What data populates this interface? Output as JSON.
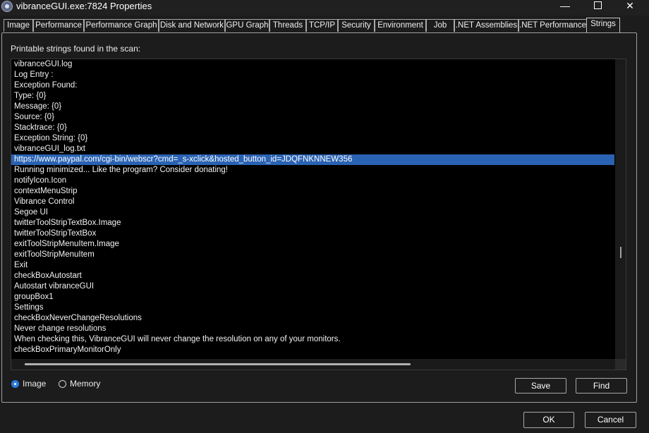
{
  "window": {
    "title": "vibranceGUI.exe:7824 Properties",
    "controls": {
      "minimize": "—",
      "close": "✕"
    }
  },
  "tabs": [
    {
      "label": "Image"
    },
    {
      "label": "Performance"
    },
    {
      "label": "Performance Graph"
    },
    {
      "label": "Disk and Network"
    },
    {
      "label": "GPU Graph"
    },
    {
      "label": "Threads"
    },
    {
      "label": "TCP/IP"
    },
    {
      "label": "Security"
    },
    {
      "label": "Environment"
    },
    {
      "label": "Job"
    },
    {
      "label": ".NET Assemblies"
    },
    {
      "label": ".NET Performance"
    },
    {
      "label": "Strings"
    }
  ],
  "active_tab": "Strings",
  "strings_panel": {
    "heading": "Printable strings found in the scan:",
    "items": [
      "vibranceGUI.log",
      "Log Entry :",
      "Exception Found:",
      "Type: {0}",
      "Message: {0}",
      "Source: {0}",
      "Stacktrace: {0}",
      "Exception String: {0}",
      "vibranceGUI_log.txt",
      "https://www.paypal.com/cgi-bin/webscr?cmd=_s-xclick&hosted_button_id=JDQFNKNNEW356",
      "Running minimized... Like the program? Consider donating!",
      "notifyIcon.Icon",
      "contextMenuStrip",
      "Vibrance Control",
      "Segoe UI",
      "twitterToolStripTextBox.Image",
      "twitterToolStripTextBox",
      "exitToolStripMenuItem.Image",
      "exitToolStripMenuItem",
      "Exit",
      "checkBoxAutostart",
      "Autostart vibranceGUI",
      "groupBox1",
      "Settings",
      "checkBoxNeverChangeResolutions",
      "Never change resolutions",
      "When checking this, VibranceGUI will never change the resolution on any of your monitors.",
      "checkBoxPrimaryMonitorOnly"
    ],
    "selected_index": 9
  },
  "source_options": {
    "image_label": "Image",
    "memory_label": "Memory",
    "selected": "Image"
  },
  "buttons": {
    "save": "Save",
    "find": "Find",
    "ok": "OK",
    "cancel": "Cancel"
  }
}
